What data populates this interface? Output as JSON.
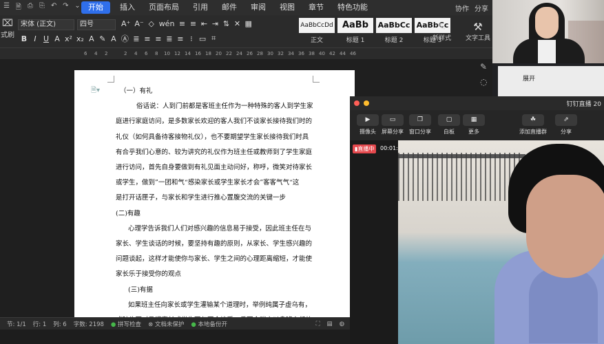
{
  "quick_icons": [
    "☰",
    "🗎",
    "⎙",
    "⎘",
    "↶",
    "↷",
    "⌄"
  ],
  "menu": {
    "tabs": [
      "开始",
      "插入",
      "页面布局",
      "引用",
      "邮件",
      "审阅",
      "视图",
      "章节",
      "特色功能"
    ],
    "right": [
      "协作",
      "分享"
    ]
  },
  "ribbon": {
    "left_label": "式刷",
    "font_name": "宋体 (正文)",
    "font_size": "四号",
    "row1_icons": [
      "A⁺",
      "A⁻",
      "◇",
      "wén",
      "≡",
      "≡",
      "⇤",
      "⇥",
      "⇅",
      "✕",
      "▦"
    ],
    "row2_icons": [
      "B",
      "I",
      "U",
      "A",
      "x²",
      "x₂",
      "A",
      "✎",
      "A",
      "Ⓐ",
      "≣",
      "≡",
      "≡",
      "≣",
      "≡",
      "⁝",
      "▭",
      "⌗"
    ],
    "styles": [
      {
        "sample": "AaBbCcDd",
        "label": "正文",
        "size": "small"
      },
      {
        "sample": "AaBb",
        "label": "标题 1",
        "size": "big"
      },
      {
        "sample": "AaBbCc",
        "label": "标题 2",
        "size": "mid"
      },
      {
        "sample": "AaBbCc",
        "label": "标题 3",
        "size": "mid"
      }
    ],
    "new_style": "新样式",
    "text_tools": "文字工具"
  },
  "ruler": [
    "6",
    "4",
    "2",
    "2",
    "4",
    "6",
    "8",
    "10",
    "12",
    "14",
    "16",
    "18",
    "20",
    "22",
    "24",
    "26",
    "28",
    "30",
    "32",
    "34",
    "36",
    "38",
    "40",
    "42",
    "44",
    "46"
  ],
  "document": {
    "lines": [
      "（一）有礼",
      "俗话说：人到门前都是客班主任作为一种特殊的客人到学生家",
      "庭进行家庭访问，是多数家长欢迎的客人我们不谈家长接待我们时的",
      "礼仪（如何具备待客接物礼仪），也不要期望学生家长接待我们时具",
      "有合乎我们心意的、较为讲究的礼仪作为班主任或教师到了学生家庭",
      "进行访问，首先自身要做到有礼见面主动问好，称呼，微笑对待家长",
      "或学生，做到”一团和气“感染家长或学生家长才会”客客气气“这",
      "是打开话匣子，与家长和学生进行推心置腹交流的关键一步",
      "(二)有趣",
      "心理学告诉我们人们对感兴趣的信息易于接受，因此班主任在与",
      "家长、学生谈话的时候，要坚持有趣的原则，从家长、学生感兴趣的",
      "问题谈起，这样才能使你与家长、学生之间的心理距离缩短，才能使",
      "家长乐于接受你的观点",
      "(三)有据",
      "如果班主任向家长或学生灌输某个道理时，举例纯属子虚乌有，",
      "或驴头不对马嘴家长或学生不仅不会接受，反而会嗤之以鼻班主任的"
    ]
  },
  "status": {
    "page": "节: 1/1",
    "row": "行: 1",
    "col": "列: 6",
    "words": "字数: 2198",
    "spell": "拼写检查",
    "protect": "文档未保护",
    "backup": "本地备份开"
  },
  "side_panel": {
    "expand": "展开"
  },
  "dingtalk": {
    "title": "钉钉直播 20",
    "toolbar": [
      {
        "icon": "▶",
        "label": "摄像头"
      },
      {
        "icon": "▭",
        "label": "屏幕分享"
      },
      {
        "icon": "❐",
        "label": "窗口分享"
      },
      {
        "icon": "▢",
        "label": "白板"
      },
      {
        "icon": "▦",
        "label": "更多"
      },
      {
        "icon": "☘",
        "label": "添加直播群"
      },
      {
        "icon": "⇗",
        "label": "分享"
      }
    ],
    "live_badge": "直播中",
    "live_time": "00:01:44"
  },
  "colors": {
    "accent": "#2f6feb",
    "live": "#e5484d",
    "ok": "#46b84a"
  }
}
